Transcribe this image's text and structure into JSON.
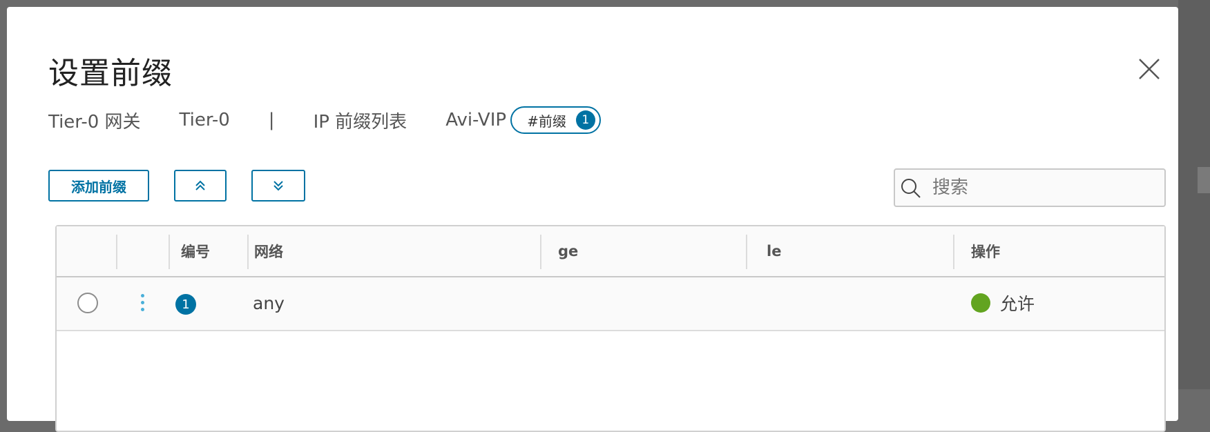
{
  "dialog": {
    "title": "设置前缀",
    "breadcrumb": {
      "gateway_type": "Tier-0 网关",
      "gateway_name": "Tier-0",
      "separator": "|",
      "list_type": "IP 前缀列表",
      "list_name": "Avi-VIP",
      "prefix_tag_label": "#前缀",
      "prefix_count": "1"
    }
  },
  "toolbar": {
    "add_label": "添加前缀",
    "move_up_icon": "double-chevron-up-icon",
    "move_down_icon": "double-chevron-down-icon"
  },
  "search": {
    "placeholder": "搜索",
    "value": ""
  },
  "table": {
    "columns": [
      "编号",
      "网络",
      "ge",
      "le",
      "操作"
    ],
    "rows": [
      {
        "number": "1",
        "network": "any",
        "ge": "",
        "le": "",
        "action": "允许",
        "action_color": "#62a420"
      }
    ]
  },
  "colors": {
    "accent": "#0072a3",
    "allow": "#62a420"
  }
}
